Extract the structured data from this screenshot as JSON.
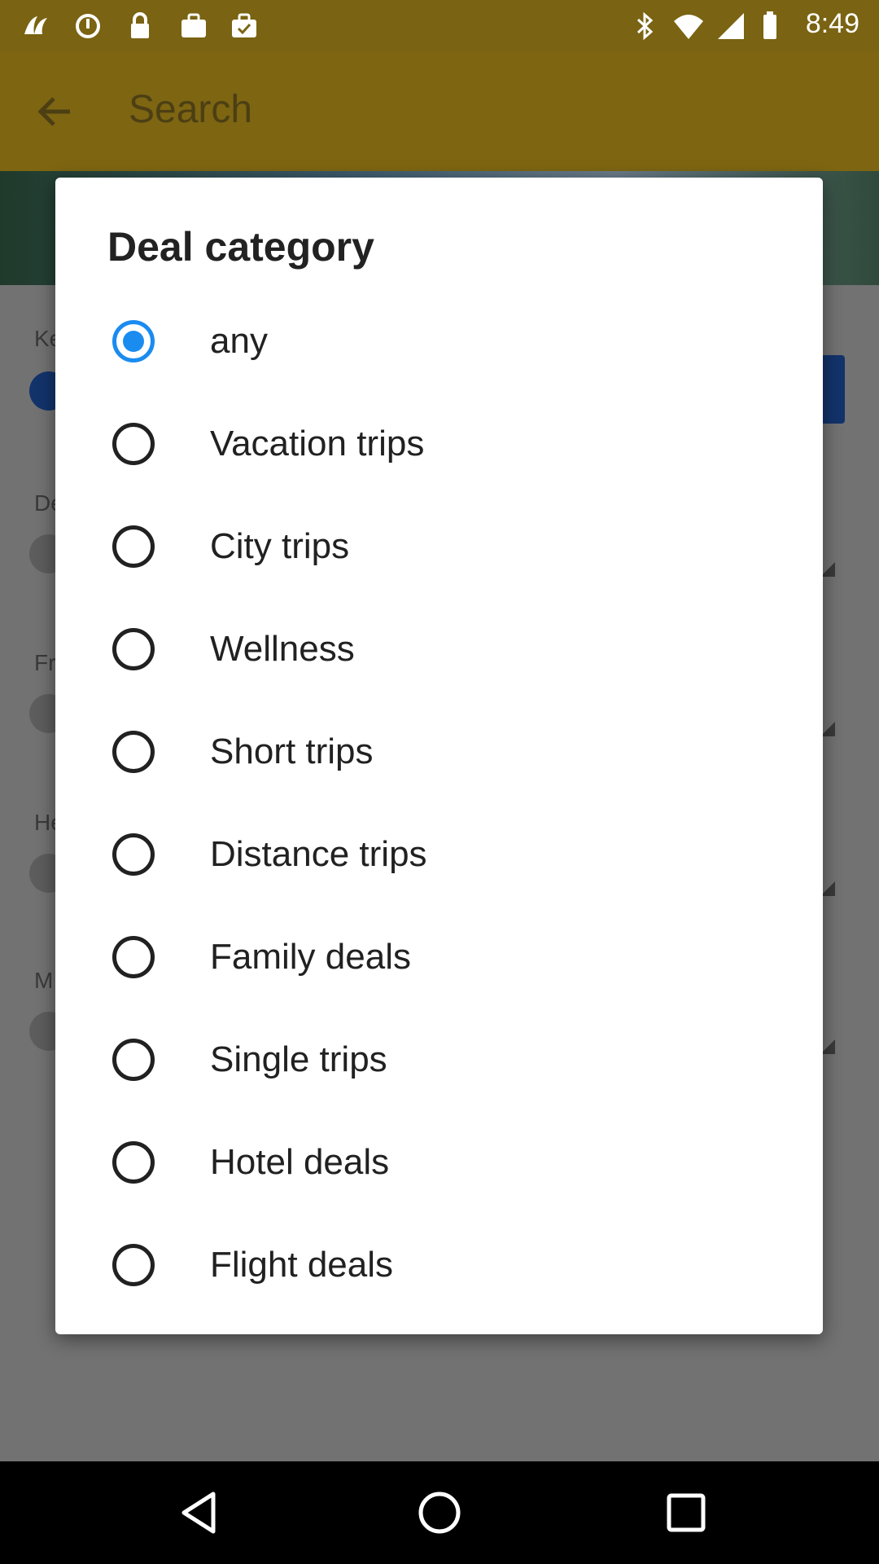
{
  "status_bar": {
    "time": "8:49",
    "icons": [
      "fins-icon",
      "sync-icon",
      "lock-icon",
      "briefcase-icon",
      "check-briefcase-icon",
      "bluetooth-icon",
      "wifi-icon",
      "signal-icon",
      "battery-icon"
    ]
  },
  "app_bar": {
    "title": "Search",
    "back_icon": "arrow-left-icon"
  },
  "background_labels": [
    "Ke",
    "De",
    "Fr",
    "He",
    "M"
  ],
  "dialog": {
    "title": "Deal category",
    "options": [
      {
        "label": "any",
        "selected": true
      },
      {
        "label": "Vacation trips",
        "selected": false
      },
      {
        "label": "City trips",
        "selected": false
      },
      {
        "label": "Wellness",
        "selected": false
      },
      {
        "label": "Short trips",
        "selected": false
      },
      {
        "label": "Distance trips",
        "selected": false
      },
      {
        "label": "Family deals",
        "selected": false
      },
      {
        "label": "Single trips",
        "selected": false
      },
      {
        "label": "Hotel deals",
        "selected": false
      },
      {
        "label": "Flight deals",
        "selected": false
      }
    ]
  },
  "colors": {
    "accent": "#1a8cf0",
    "app_bar_dimmed": "#7d6512"
  },
  "nav_bar": {
    "buttons": [
      "back-triangle-icon",
      "home-circle-icon",
      "recents-square-icon"
    ]
  }
}
